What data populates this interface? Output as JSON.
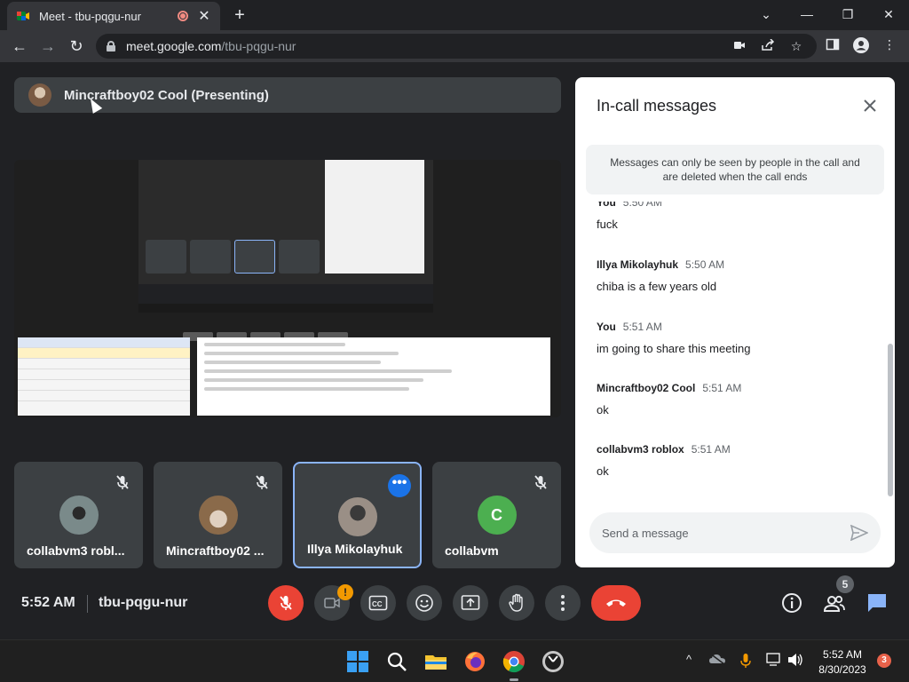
{
  "browser": {
    "tab_title": "Meet - tbu-pqgu-nur",
    "url_host": "meet.google.com",
    "url_path": "/tbu-pqgu-nur"
  },
  "presenter": {
    "label": "Mincraftboy02 Cool (Presenting)"
  },
  "participants": [
    {
      "name": "collabvm3 robl...",
      "muted": true,
      "avatar_color": "#7a8a8a"
    },
    {
      "name": "Mincraftboy02 ...",
      "muted": true,
      "avatar_color": "#8a6a4a"
    },
    {
      "name": "Illya Mikolayhuk",
      "muted": false,
      "active": true,
      "avatar_color": "#9a8f86"
    },
    {
      "name": "collabvm",
      "muted": true,
      "initial": "C",
      "avatar_color": "#4caf50"
    }
  ],
  "chat": {
    "title": "In-call messages",
    "notice": "Messages can only be seen by people in the call and are deleted when the call ends",
    "messages": [
      {
        "sender": "You",
        "time": "5:50 AM",
        "text": "fuck"
      },
      {
        "sender": "Illya Mikolayhuk",
        "time": "5:50 AM",
        "text": "chiba is a few years old"
      },
      {
        "sender": "You",
        "time": "5:51 AM",
        "text": "im going to share this meeting"
      },
      {
        "sender": "Mincraftboy02 Cool",
        "time": "5:51 AM",
        "text": "ok"
      },
      {
        "sender": "collabvm3 roblox",
        "time": "5:51 AM",
        "text": "ok"
      }
    ],
    "input_placeholder": "Send a message"
  },
  "bottom_bar": {
    "time": "5:52 AM",
    "meeting_code": "tbu-pqgu-nur",
    "camera_badge": "!",
    "people_count": "5"
  },
  "taskbar": {
    "time": "5:52 AM",
    "date": "8/30/2023",
    "notification_count": "3"
  },
  "colors": {
    "accent_blue": "#8ab4f8",
    "end_call_red": "#ea4335",
    "chat_icon_blue": "#8ab4f8"
  }
}
